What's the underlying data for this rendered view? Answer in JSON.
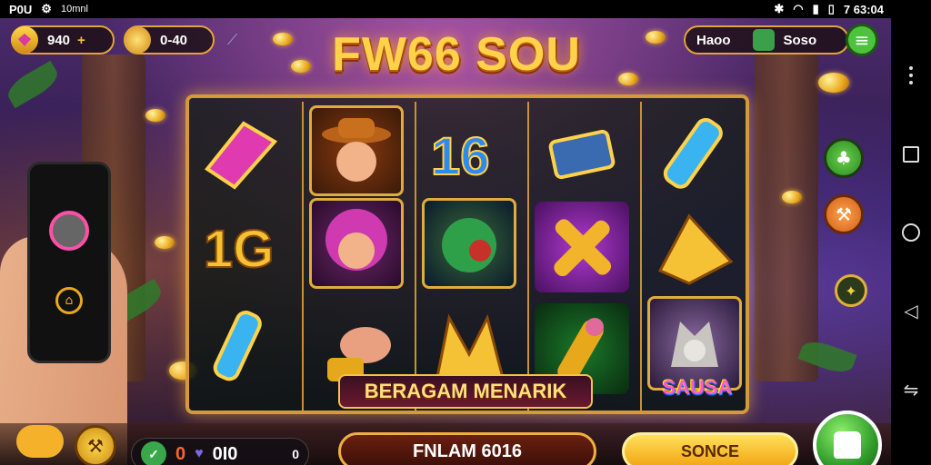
{
  "status_bar": {
    "time": "P0U",
    "carrier": "10mnl",
    "right_time": "7 63:04"
  },
  "hud": {
    "balance": "940",
    "balance_suffix": "+",
    "bet": "0-40",
    "right_label": "Haoo",
    "right_value": "Soso"
  },
  "title": "FW66 SOU",
  "banner": "BERAGAM MENARIK",
  "badge_label": "SAUSA",
  "bottom": {
    "credit_value": "0I0",
    "credit_prefix": "0",
    "credit_suffix": "0",
    "spin_amount": "FNLAM 6016",
    "action_label": "SONCE"
  },
  "colors": {
    "accent_gold": "#f1a312",
    "title_gold": "#ffd24a",
    "frame_gold": "#d39a38",
    "green": "#2f9a2a"
  },
  "icons": [
    "gem-icon",
    "coin-icon",
    "menu-icon",
    "cash-icon",
    "tree-icon",
    "hammer-icon",
    "star-icon",
    "wrench-icon",
    "check-icon",
    "heart-icon"
  ]
}
